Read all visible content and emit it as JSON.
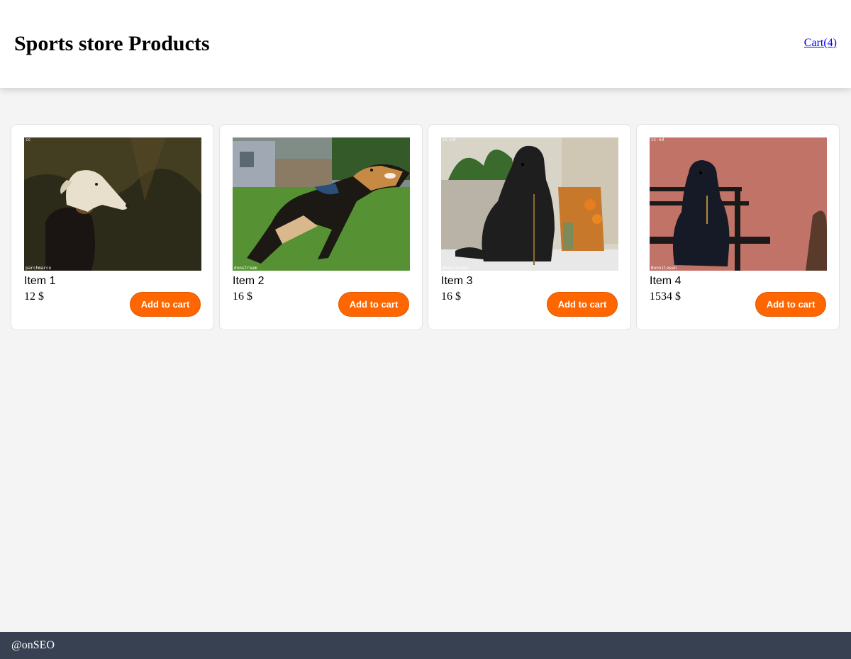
{
  "header": {
    "title": "Sports store Products",
    "cart_label": "Cart(4)"
  },
  "products": [
    {
      "name": "Item 1",
      "price": "12 $",
      "button": "Add to cart",
      "photo_license": "cc",
      "photo_credit": "parchmarco"
    },
    {
      "name": "Item 2",
      "price": "16 $",
      "button": "Add to cart",
      "photo_license": "",
      "photo_credit": "donstream"
    },
    {
      "name": "Item 3",
      "price": "16 $",
      "button": "Add to cart",
      "photo_license": "cc-nd",
      "photo_credit": "Bonnilosen"
    },
    {
      "name": "Item 4",
      "price": "1534 $",
      "button": "Add to cart",
      "photo_license": "cc-nd",
      "photo_credit": "Bonnilosen"
    }
  ],
  "footer": {
    "text": "@onSEO"
  },
  "colors": {
    "accent": "#ff6600",
    "footer_bg": "#374151",
    "page_bg": "#f4f4f4"
  }
}
